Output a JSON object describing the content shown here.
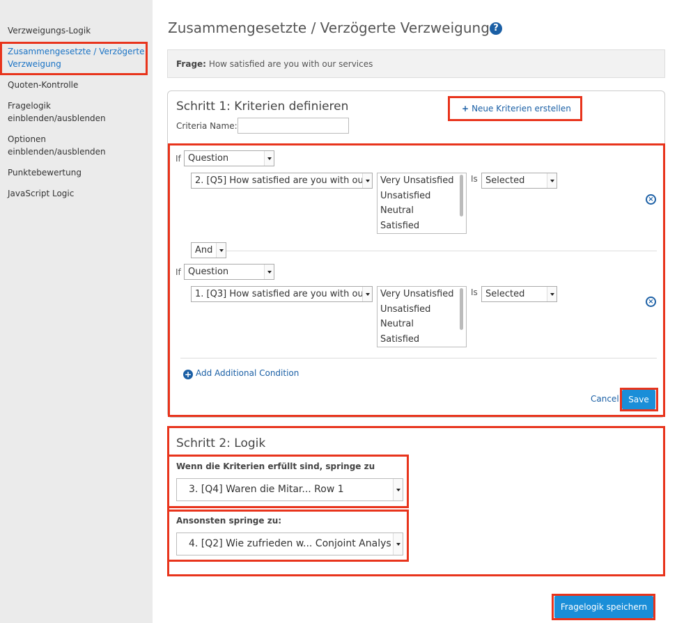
{
  "sidebar": {
    "items": [
      {
        "label": "Verzweigungs-Logik"
      },
      {
        "label": "Zusammengesetzte / Verzögerte Verzweigung"
      },
      {
        "label": "Quoten-Kontrolle"
      },
      {
        "label": "Fragelogik einblenden/ausblenden"
      },
      {
        "label": "Optionen einblenden/ausblenden"
      },
      {
        "label": "Punktebewertung"
      },
      {
        "label": "JavaScript Logic"
      }
    ]
  },
  "header": {
    "title": "Zusammengesetzte / Verzögerte Verzweigung",
    "help_icon": "question-circle-icon"
  },
  "question": {
    "label": "Frage:",
    "text": "How satisfied are you with our services"
  },
  "step1": {
    "title": "Schritt 1: Kriterien definieren",
    "new_criteria_label": "Neue Kriterien erstellen",
    "criteria_name_label": "Criteria Name:",
    "criteria_name_value": "",
    "conditions": [
      {
        "if_label": "If",
        "type": "Question",
        "question": "2. [Q5] How satisfied are you with our",
        "options": [
          "Very Unsatisfied",
          "Unsatisfied",
          "Neutral",
          "Satisfied"
        ],
        "is_label": "Is",
        "state": "Selected"
      },
      {
        "if_label": "If",
        "type": "Question",
        "question": "1. [Q3] How satisfied are you with our",
        "options": [
          "Very Unsatisfied",
          "Unsatisfied",
          "Neutral",
          "Satisfied"
        ],
        "is_label": "Is",
        "state": "Selected"
      }
    ],
    "connector": "And",
    "add_condition_label": "Add Additional Condition",
    "cancel_label": "Cancel",
    "save_label": "Save"
  },
  "step2": {
    "title": "Schritt 2: Logik",
    "if_met_label": "Wenn die Kriterien erfüllt sind, springe zu",
    "if_met_value": "3. [Q4] Waren die Mitar... Row 1",
    "else_label": "Ansonsten springe zu:",
    "else_value": "4. [Q2] Wie zufrieden w... Conjoint Analys"
  },
  "footer": {
    "save_logic_label": "Fragelogik speichern"
  },
  "colors": {
    "accent": "#1a8ed8",
    "link": "#1a5fa5",
    "highlight": "#e8341c"
  }
}
